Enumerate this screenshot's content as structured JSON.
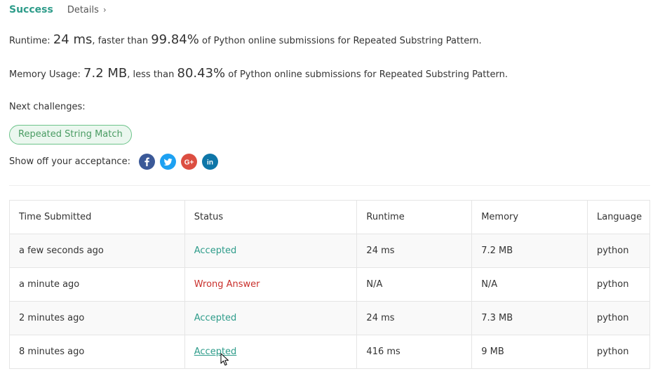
{
  "header": {
    "status": "Success",
    "details_label": "Details",
    "details_chevron": "›"
  },
  "runtime": {
    "label": "Runtime:",
    "value": "24 ms",
    "middle": ", faster than",
    "percent": "99.84%",
    "suffix": "of Python online submissions for Repeated Substring Pattern."
  },
  "memory": {
    "label": "Memory Usage:",
    "value": "7.2 MB",
    "middle": ", less than",
    "percent": "80.43%",
    "suffix": "of Python online submissions for Repeated Substring Pattern."
  },
  "next": {
    "label": "Next challenges:",
    "challenges": [
      "Repeated String Match"
    ]
  },
  "share": {
    "label": "Show off your acceptance:",
    "icons": [
      "facebook-icon",
      "twitter-icon",
      "google-plus-icon",
      "linkedin-icon"
    ]
  },
  "table": {
    "columns": [
      "Time Submitted",
      "Status",
      "Runtime",
      "Memory",
      "Language"
    ],
    "rows": [
      {
        "time": "a few seconds ago",
        "status": "Accepted",
        "runtime": "24 ms",
        "memory": "7.2 MB",
        "language": "python"
      },
      {
        "time": "a minute ago",
        "status": "Wrong Answer",
        "runtime": "N/A",
        "memory": "N/A",
        "language": "python"
      },
      {
        "time": "2 minutes ago",
        "status": "Accepted",
        "runtime": "24 ms",
        "memory": "7.3 MB",
        "language": "python"
      },
      {
        "time": "8 minutes ago",
        "status": "Accepted",
        "runtime": "416 ms",
        "memory": "9 MB",
        "language": "python"
      }
    ]
  },
  "colors": {
    "accepted": "#2e9c8a",
    "wrong": "#c9302c",
    "pill_border": "#6cc38a"
  }
}
